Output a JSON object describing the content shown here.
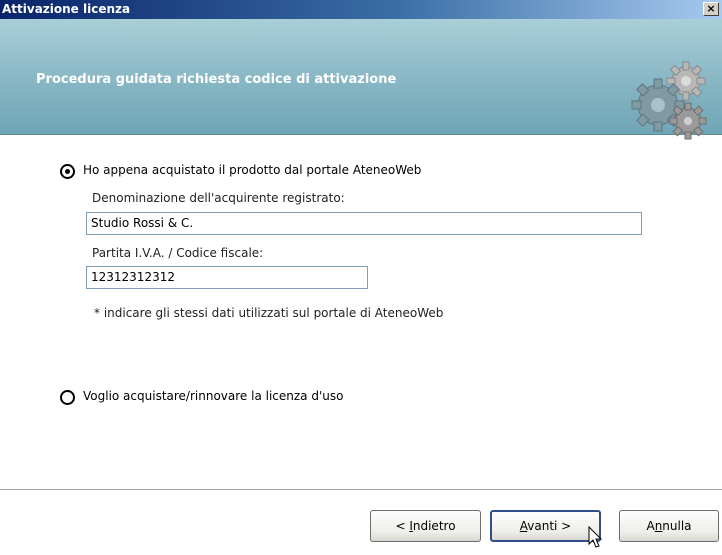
{
  "window": {
    "title": "Attivazione licenza",
    "close_label": "×"
  },
  "banner": {
    "heading": "Procedura guidata richiesta codice di attivazione",
    "icon": "gears-icon"
  },
  "option_purchased": {
    "label": "Ho appena acquistato il prodotto dal portale AteneoWeb",
    "selected": true,
    "buyer_label": "Denominazione dell'acquirente registrato:",
    "buyer_value": "Studio Rossi & C.",
    "vat_label": "Partita I.V.A. / Codice fiscale:",
    "vat_value": "12312312312",
    "note": "* indicare gli stessi dati utilizzati sul portale di AteneoWeb"
  },
  "option_buy": {
    "label": "Voglio acquistare/rinnovare la licenza d'uso",
    "selected": false
  },
  "buttons": {
    "back_prefix": "< ",
    "back_mnemonic": "I",
    "back_rest": "ndietro",
    "next_mnemonic": "A",
    "next_rest": "vanti >",
    "cancel_prefix": "A",
    "cancel_mnemonic": "n",
    "cancel_rest": "nulla"
  }
}
